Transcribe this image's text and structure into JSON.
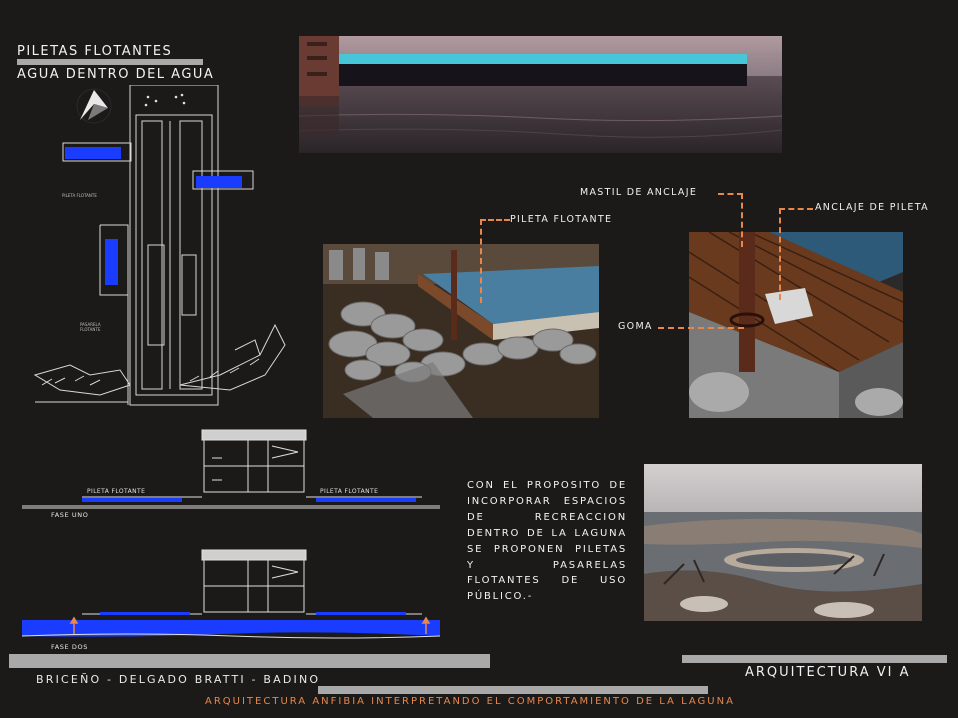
{
  "header": {
    "title": "PILETAS FLOTANTES",
    "subtitle": "AGUA DENTRO DEL AGUA"
  },
  "plan": {
    "label_pileta": "PILETA FLOTANTE",
    "label_pasarela": "PASARELA FLOTANTE"
  },
  "sections": {
    "fase_uno": "FASE UNO",
    "fase_dos": "FASE DOS",
    "pileta_left": "PILETA FLOTANTE",
    "pileta_right": "PILETA FLOTANTE"
  },
  "render_labels": {
    "pileta_flotante": "PILETA FLOTANTE",
    "mastil": "MASTIL DE ANCLAJE",
    "anclaje": "ANCLAJE DE PILETA",
    "goma": "GOMA"
  },
  "description": "CON EL PROPOSITO DE INCORPORAR ESPACIOS DE RECREACCION DENTRO DE LA LAGUNA SE PROPONEN PILETAS Y PASARELAS FLOTANTES DE USO PÚBLICO.-",
  "footer": {
    "authors": "BRICEÑO - DELGADO BRATTI - BADINO",
    "course": "ARQUITECTURA VI A",
    "subtitle": "ARQUITECTURA ANFIBIA INTERPRETANDO EL COMPORTAMIENTO DE LA LAGUNA"
  },
  "colors": {
    "background": "#1c1a19",
    "accent_orange": "#e8874a",
    "pool_blue": "#1a3cff",
    "bar_gray": "#a9a9a9"
  }
}
